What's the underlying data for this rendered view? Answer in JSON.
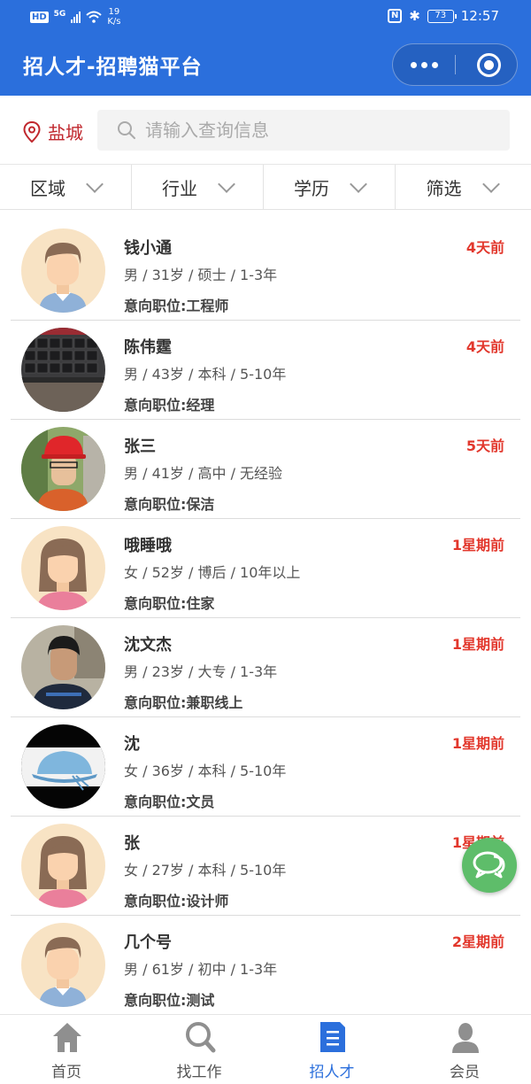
{
  "status_bar": {
    "hd": "HD",
    "network": "5G",
    "speed_value": "19",
    "speed_unit": "K/s",
    "nfc": "N",
    "battery": "73",
    "time": "12:57"
  },
  "nav": {
    "title": "招人才-招聘猫平台"
  },
  "search": {
    "city": "盐城",
    "placeholder": "请输入查询信息"
  },
  "filters": [
    "区域",
    "行业",
    "学历",
    "筛选"
  ],
  "candidates": [
    {
      "name": "钱小通",
      "meta": "男 / 31岁 / 硕士 / 1-3年",
      "position": "意向职位:工程师",
      "time": "4天前",
      "avatar": "male-cartoon"
    },
    {
      "name": "陈伟霆",
      "meta": "男 / 43岁 / 本科 / 5-10年",
      "position": "意向职位:经理",
      "time": "4天前",
      "avatar": "keyboard-photo"
    },
    {
      "name": "张三",
      "meta": "男 / 41岁 / 高中 / 无经验",
      "position": "意向职位:保洁",
      "time": "5天前",
      "avatar": "man-red-helmet-photo"
    },
    {
      "name": "哦睡哦",
      "meta": "女 / 52岁 / 博后 / 10年以上",
      "position": "意向职位:住家",
      "time": "1星期前",
      "avatar": "female-cartoon"
    },
    {
      "name": "沈文杰",
      "meta": "男 / 23岁 / 大专 / 1-3年",
      "position": "意向职位:兼职线上",
      "time": "1星期前",
      "avatar": "young-man-photo"
    },
    {
      "name": "沈",
      "meta": "女 / 36岁 / 本科 / 5-10年",
      "position": "意向职位:文员",
      "time": "1星期前",
      "avatar": "blue-hat-photo"
    },
    {
      "name": "张",
      "meta": "女 / 27岁 / 本科 / 5-10年",
      "position": "意向职位:设计师",
      "time": "1星期前",
      "avatar": "female-cartoon"
    },
    {
      "name": "几个号",
      "meta": "男 / 61岁 / 初中 / 1-3年",
      "position": "意向职位:测试",
      "time": "2星期前",
      "avatar": "male-cartoon"
    }
  ],
  "tabs": [
    {
      "label": "首页",
      "icon": "home-icon",
      "active": false
    },
    {
      "label": "找工作",
      "icon": "search-icon",
      "active": false
    },
    {
      "label": "招人才",
      "icon": "document-icon",
      "active": true
    },
    {
      "label": "会员",
      "icon": "user-icon",
      "active": false
    }
  ],
  "colors": {
    "brand_blue": "#2b6fdc",
    "time_red": "#e2372c",
    "city_red": "#c0272d",
    "chat_green": "#5ebd6a"
  }
}
